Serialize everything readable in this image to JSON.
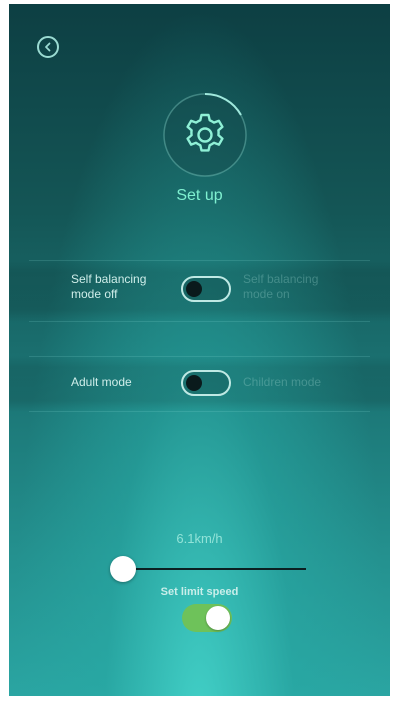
{
  "header": {
    "back_icon": "chevron-left-icon",
    "gear_icon": "gear-icon",
    "title": "Set up"
  },
  "balance_row": {
    "left_label_line1": "Self balancing",
    "left_label_line2": "mode off",
    "right_label_line1": "Self balancing",
    "right_label_line2": "mode on",
    "toggle_on": false
  },
  "mode_row": {
    "left_label": "Adult mode",
    "right_label": "Children mode",
    "toggle_on": false
  },
  "speed": {
    "value_text": "6.1km/h",
    "slider_fraction": 0.0,
    "limit_label": "Set limit speed",
    "limit_enabled": true
  },
  "colors": {
    "accent": "#7ff0d0",
    "switch_on": "#6ec25a",
    "background_top": "#0d3f43",
    "background_bottom": "#2aa5a2"
  }
}
